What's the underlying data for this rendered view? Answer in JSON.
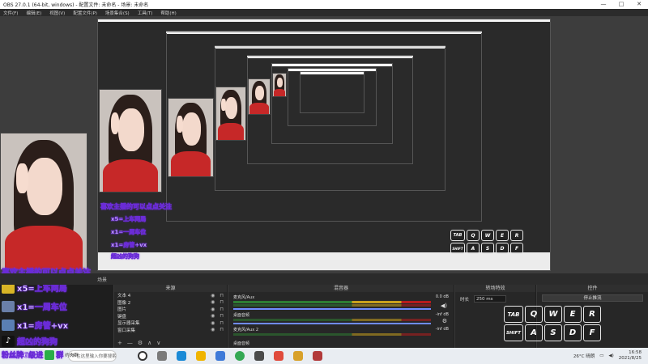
{
  "window": {
    "title": "OBS 27.0.1 (64-bit, windows) - 配置文件: 未命名 - 场景: 未命名",
    "controls": [
      "—",
      "□",
      "✕"
    ]
  },
  "menu": [
    "文件(F)",
    "编辑(E)",
    "视图(V)",
    "配置文件(P)",
    "场景集合(S)",
    "工具(T)",
    "帮助(H)"
  ],
  "overlay": {
    "follow_text": "喜欢主播的可以点点关注",
    "rules": [
      {
        "icon": "gold-bar-icon",
        "color": "#d9b526",
        "text": "x5=上车两局"
      },
      {
        "icon": "ring-icon",
        "color": "#6a7fa8",
        "text": "x1=一周车位"
      },
      {
        "icon": "sports-car-icon",
        "color": "#5a7fb3",
        "text": "x1=房管+vx"
      },
      {
        "icon": "tiktok-icon",
        "color": "#111111",
        "text": "超凶的狗狗"
      }
    ],
    "fans_text": "粉丝牌6级进",
    "fans_suffix": "群",
    "group_text": "约肉群"
  },
  "keys": {
    "row1": [
      "TAB",
      "Q",
      "W",
      "E",
      "R"
    ],
    "row2": [
      "SHIFT",
      "A",
      "S",
      "D",
      "F"
    ]
  },
  "docks": {
    "tab_label": "场景",
    "sources_title": "来源",
    "mixer_title": "混音器",
    "transitions_title": "转场特效",
    "controls_title": "控件"
  },
  "sources": [
    {
      "name": "文本 4"
    },
    {
      "name": "图像 2"
    },
    {
      "name": "图片"
    },
    {
      "name": "键盘"
    },
    {
      "name": "显示器采集"
    },
    {
      "name": "窗口采集"
    }
  ],
  "source_tools": [
    "+",
    "—",
    "⚙",
    "∧",
    "∨"
  ],
  "mixer": [
    {
      "name": "麦克风/Aux",
      "db": "0.0 dB"
    },
    {
      "name": "桌面音频",
      "db": "-inf dB"
    },
    {
      "name": "麦克风/Aux 2",
      "db": "-inf dB"
    }
  ],
  "mixer_footer": "桌面音频",
  "transition": {
    "duration_label": "时长",
    "duration_value": "250 ms"
  },
  "controls": [
    "停止推流"
  ],
  "taskbar": {
    "search_placeholder": "在这里输入你要搜索的内容",
    "weather": "26°C 晴朗",
    "time": "16:58",
    "date": "2021/8/25"
  },
  "colors": {
    "accent_purple": "#7b2ff7",
    "meter_green": "#2e7d32",
    "meter_yellow": "#c9a11c",
    "shirt_red": "#c62828"
  }
}
